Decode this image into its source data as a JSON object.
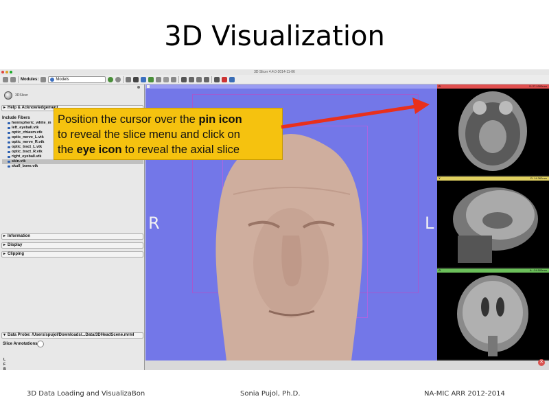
{
  "slide": {
    "title": "3D Visualization",
    "footer_left": "3D Data Loading and VisualizaBon",
    "footer_center": "Sonia Pujol, Ph.D.",
    "footer_right": "NA-MIC ARR 2012-2014"
  },
  "app": {
    "window_title": "3D Slicer 4.4.0-2014-11-06",
    "toolbar": {
      "modules_label": "Modules:",
      "module_selected": "Models"
    },
    "panel": {
      "logo_text": "3DSlicer",
      "help_section": "Help & Acknowledgement",
      "fibers_label": "Include Fibers",
      "fibers": [
        "hemispheric_white_m",
        "left_eyeball.vtk",
        "optic_chiasm.vtk",
        "optic_nerve_L.vtk",
        "optic_nerve_R.vtk",
        "optic_tract_L.vtk",
        "optic_tract_R.vtk",
        "right_eyeball.vtk",
        "skin.vtk",
        "skull_bone.vtk"
      ],
      "selected_fiber_index": 8,
      "information_section": "Information",
      "display_section": "Display",
      "clipping_section": "Clipping",
      "data_probe": "Data Probe: /Users/spujol/Downloads/...Data/3DHeadScene.mrml",
      "slice_annotations": "Slice Annotations:",
      "orientation_letters": [
        "L",
        "F",
        "B"
      ]
    },
    "view3d": {
      "left_label": "R",
      "right_label": "L",
      "background_color": "#7377e8",
      "head_color": "#d9b8a8"
    },
    "slice_views": [
      {
        "name": "R",
        "offset": "S: 27.1000mm",
        "bar_color": "#e05050"
      },
      {
        "name": "Y",
        "offset": "R: 14.362mm",
        "bar_color": "#e0d060"
      },
      {
        "name": "G",
        "offset": "A: -24.500mm",
        "bar_color": "#6bbf5a"
      }
    ]
  },
  "callout": {
    "line1_pre": "Position the cursor over the ",
    "line1_bold": "pin icon",
    "line2": "to reveal the slice menu and click on",
    "line3_pre": "the ",
    "line3_bold": "eye icon",
    "line3_post": " to reveal the axial slice",
    "color": "#f5c20f",
    "arrow_color": "#e8301c"
  }
}
